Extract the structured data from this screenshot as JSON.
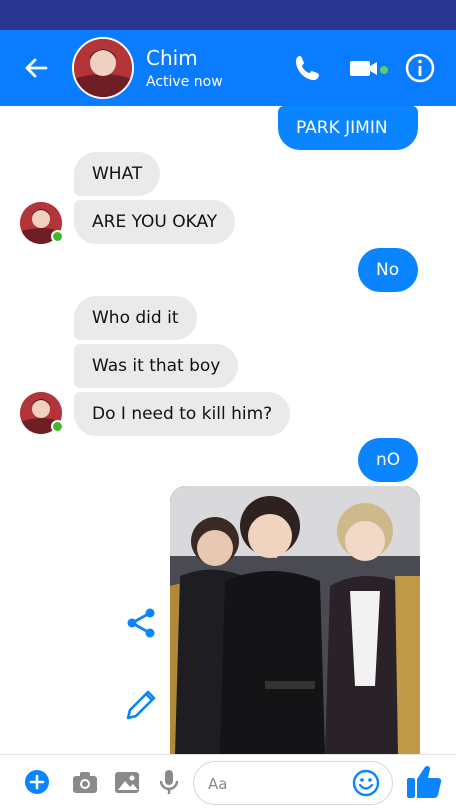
{
  "header": {
    "name": "Chim",
    "status": "Active now"
  },
  "messages": [
    {
      "side": "out",
      "text": "PARK JIMIN"
    },
    {
      "side": "in",
      "text": "WHAT"
    },
    {
      "side": "in",
      "text": "ARE YOU OKAY"
    },
    {
      "side": "out",
      "text": "No"
    },
    {
      "side": "in",
      "text": "Who did it"
    },
    {
      "side": "in",
      "text": "Was it that boy"
    },
    {
      "side": "in",
      "text": "Do I need to kill him?"
    },
    {
      "side": "out",
      "text": "nO"
    }
  ],
  "composer": {
    "placeholder": "Aa"
  },
  "colors": {
    "statusbar": "#2a3590",
    "header": "#0a7cff",
    "outgoing_bubble": "#0a84ff",
    "incoming_bubble": "#eaeaea",
    "online": "#42b72a"
  },
  "icons": [
    "back-arrow-icon",
    "phone-icon",
    "video-camera-icon",
    "info-icon",
    "share-icon",
    "pencil-icon",
    "plus-icon",
    "camera-icon",
    "image-icon",
    "microphone-icon",
    "emoji-icon",
    "thumbs-up-icon"
  ]
}
